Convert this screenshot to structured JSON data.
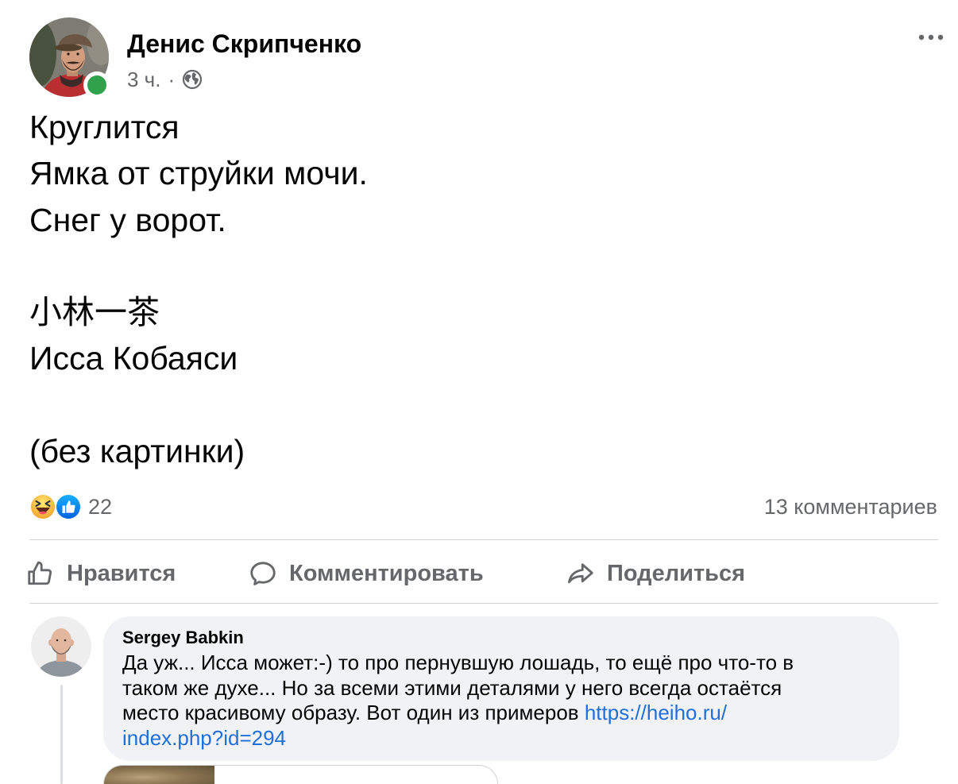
{
  "post": {
    "author": {
      "name": "Денис Скрипченко"
    },
    "time": "3 ч.",
    "separator": "·",
    "privacy_icon": "globe-icon",
    "more_icon": "more-horizontal-icon",
    "paragraphs": [
      [
        "Круглится",
        "Ямка от струйки мочи.",
        "Снег у ворот."
      ],
      [
        "小林一茶",
        "Исса Кобаяси"
      ],
      [
        "(без картинки)"
      ]
    ],
    "reactions": {
      "icons": [
        "haha-reaction-icon",
        "like-reaction-icon"
      ],
      "count": "22"
    },
    "comments_count": "13 комментариев"
  },
  "actions": [
    {
      "icon": "thumbs-up-icon",
      "label": "Нравится"
    },
    {
      "icon": "comment-icon",
      "label": "Комментировать"
    },
    {
      "icon": "share-icon",
      "label": "Поделиться"
    }
  ],
  "comment": {
    "author": "Sergey Babkin",
    "text_lines": [
      "Да уж... Исса может:-) то про пернувшую лошадь, то ещё про что-то в",
      "таком же духе... Но за всеми этими деталями у него всегда остаётся",
      "место красивому образу. Вот один из примеров"
    ],
    "link_lines": [
      "https://heiho.ru/",
      "index.php?id=294"
    ]
  },
  "colors": {
    "text": "#050505",
    "secondary": "#65676b",
    "link": "#216fdb",
    "bubble": "#f0f2f5",
    "divider": "#ced0d4",
    "online": "#31a24c"
  }
}
